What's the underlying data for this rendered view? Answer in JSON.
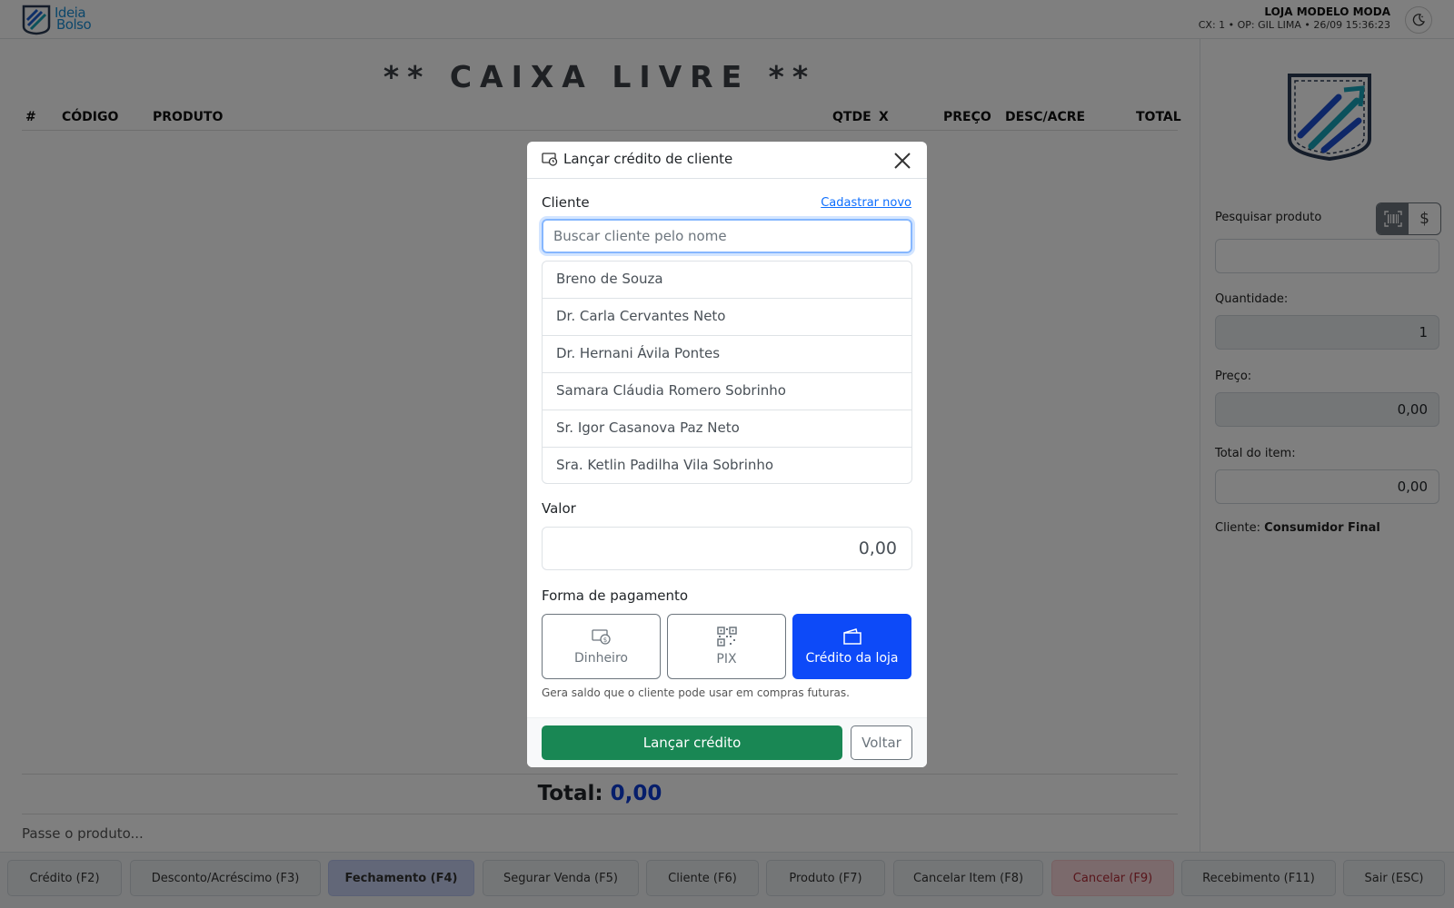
{
  "header": {
    "store_name": "LOJA MODELO MODA",
    "store_info": "CX: 1 • OP: GIL LIMA • 26/09 15:36:23",
    "logo_line1": "Ideia",
    "logo_line2": "Bolso",
    "theme_icon": "moon-icon"
  },
  "main": {
    "title": "** CAIXA LIVRE **",
    "columns": [
      "#",
      "CÓDIGO",
      "PRODUTO",
      "QTDE",
      "X",
      "PREÇO",
      "DESC/ACRE",
      "TOTAL"
    ],
    "total_label": "Total:",
    "total_value": "0,00",
    "scan_prompt": "Passe o produto..."
  },
  "panel": {
    "search_label": "Pesquisar produto",
    "search_value": "",
    "qty_label": "Quantidade:",
    "qty_value": "1",
    "price_label": "Preço:",
    "price_value": "0,00",
    "item_total_label": "Total do item:",
    "item_total_value": "0,00",
    "client_label": "Cliente:",
    "client_value": "Consumidor Final",
    "barcode_icon": "barcode-icon",
    "price_icon": "$"
  },
  "footer": {
    "buttons": [
      "Crédito (F2)",
      "Desconto/Acréscimo (F3)",
      "Fechamento (F4)",
      "Segurar Venda (F5)",
      "Cliente (F6)",
      "Produto (F7)",
      "Cancelar Item (F8)",
      "Cancelar (F9)",
      "Recebimento (F11)",
      "Sair (ESC)"
    ]
  },
  "modal": {
    "title": "Lançar crédito de cliente",
    "client_label": "Cliente",
    "register_link": "Cadastrar novo",
    "search_placeholder": "Buscar cliente pelo nome",
    "clients": [
      "Breno de Souza",
      "Dr. Carla Cervantes Neto",
      "Dr. Hernani Ávila Pontes",
      "Samara Cláudia Romero Sobrinho",
      "Sr. Igor Casanova Paz Neto",
      "Sra. Ketlin Padilha Vila Sobrinho"
    ],
    "valor_label": "Valor",
    "valor_value": "0,00",
    "payment_label": "Forma de pagamento",
    "payments": [
      {
        "label": "Dinheiro",
        "icon": "cash-icon",
        "selected": false
      },
      {
        "label": "PIX",
        "icon": "qr-code-icon",
        "selected": false
      },
      {
        "label": "Crédito da loja",
        "icon": "wallet-icon",
        "selected": true
      }
    ],
    "help_text": "Gera saldo que o cliente pode usar em compras futuras.",
    "submit_label": "Lançar crédito",
    "back_label": "Voltar"
  },
  "colors": {
    "accent": "#0d4af8",
    "success": "#198754",
    "total_value": "#0d3dd6",
    "link": "#0d6efd"
  }
}
